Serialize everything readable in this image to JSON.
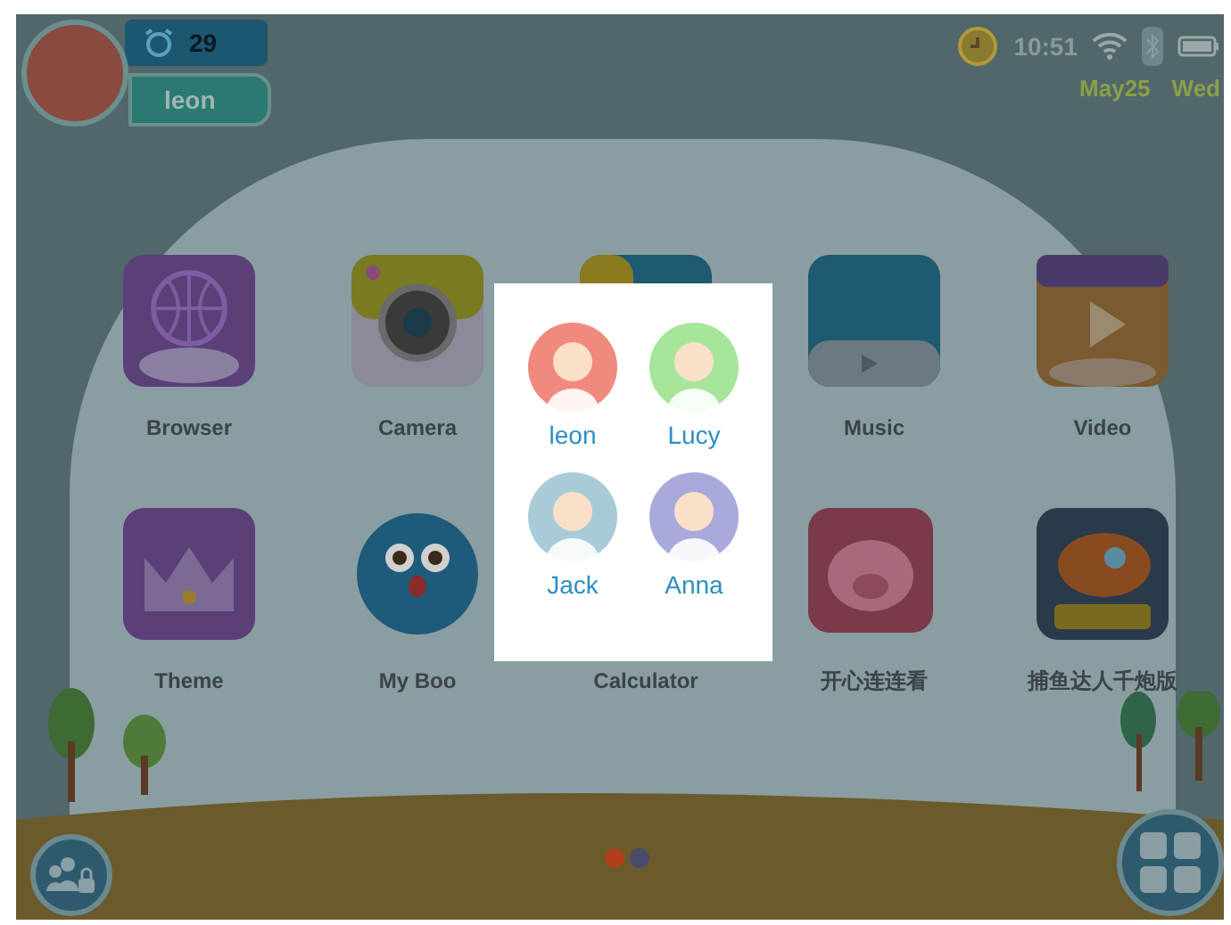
{
  "user": {
    "name": "leon",
    "alarm_count": "29"
  },
  "status_bar": {
    "time": "10:51",
    "date": "May25",
    "weekday": "Wed"
  },
  "apps": [
    {
      "kind": "browser",
      "label": "Browser"
    },
    {
      "kind": "camera",
      "label": "Camera"
    },
    {
      "kind": "hidden"
    },
    {
      "kind": "music",
      "label": "Music"
    },
    {
      "kind": "video",
      "label": "Video"
    },
    {
      "kind": "theme",
      "label": "Theme"
    },
    {
      "kind": "boo",
      "label": "My Boo"
    },
    {
      "kind": "none",
      "label": "Calculator"
    },
    {
      "kind": "pig",
      "label": "开心连连看"
    },
    {
      "kind": "fish",
      "label": "捕鱼达人千炮版"
    }
  ],
  "profiles": [
    {
      "name": "leon",
      "color": "#f08a7c"
    },
    {
      "name": "Lucy",
      "color": "#a6e59a"
    },
    {
      "name": "Jack",
      "color": "#a9cbd8"
    },
    {
      "name": "Anna",
      "color": "#a9a9dc"
    }
  ],
  "page_dots": [
    {
      "selected": true
    },
    {
      "selected": false
    }
  ]
}
